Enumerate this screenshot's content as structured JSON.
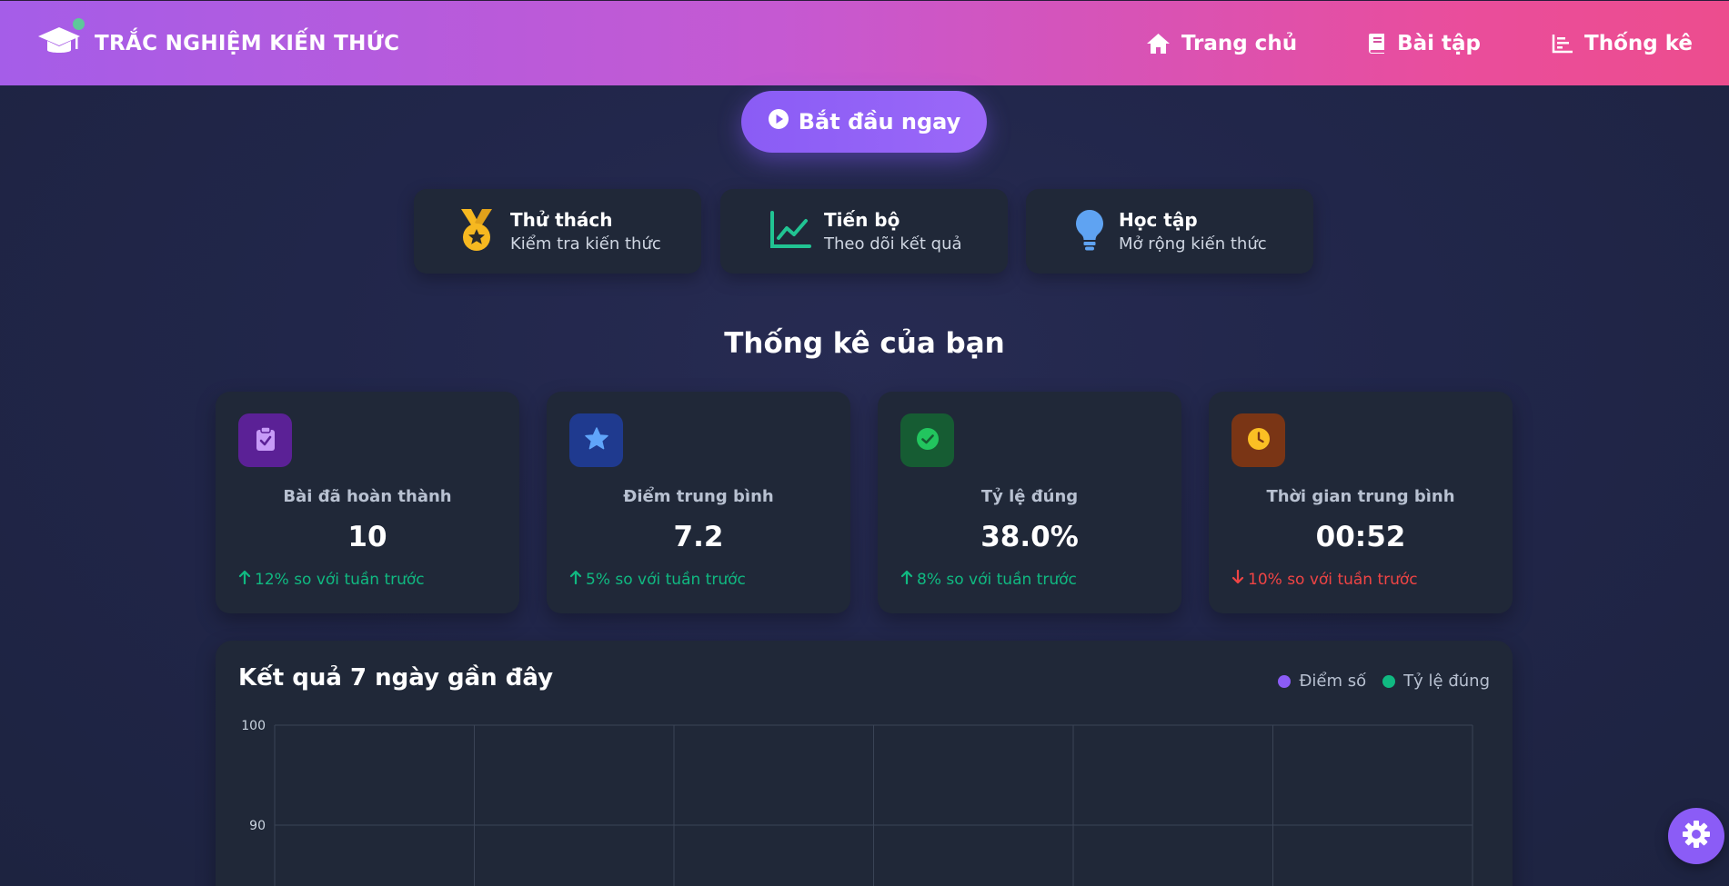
{
  "header": {
    "brand_title": "TRẮC NGHIỆM KIẾN THỨC",
    "nav": [
      {
        "label": "Trang chủ",
        "icon": "home-icon"
      },
      {
        "label": "Bài tập",
        "icon": "book-icon"
      },
      {
        "label": "Thống kê",
        "icon": "chart-bar-icon"
      }
    ]
  },
  "hero": {
    "start_label": "Bắt đầu ngay"
  },
  "features": [
    {
      "title": "Thử thách",
      "subtitle": "Kiểm tra kiến thức",
      "icon": "medal-icon",
      "color": "#f6b820"
    },
    {
      "title": "Tiến bộ",
      "subtitle": "Theo dõi kết quả",
      "icon": "line-chart-icon",
      "color": "#21c493"
    },
    {
      "title": "Học tập",
      "subtitle": "Mở rộng kiến thức",
      "icon": "lightbulb-icon",
      "color": "#5fa3f2"
    }
  ],
  "stats_section": {
    "title": "Thống kê của bạn",
    "cards": [
      {
        "label": "Bài đã hoàn thành",
        "value": "10",
        "trend": "12% so với tuần trước",
        "direction": "up",
        "icon": "clipboard-check-icon",
        "bg": "#5b2196",
        "fg": "#c79bf7"
      },
      {
        "label": "Điểm trung bình",
        "value": "7.2",
        "trend": "5% so với tuần trước",
        "direction": "up",
        "icon": "star-icon",
        "bg": "#1f3a8f",
        "fg": "#60a5fa"
      },
      {
        "label": "Tỷ lệ đúng",
        "value": "38.0%",
        "trend": "8% so với tuần trước",
        "direction": "up",
        "icon": "check-circle-icon",
        "bg": "#165c33",
        "fg": "#22c55e"
      },
      {
        "label": "Thời gian trung bình",
        "value": "00:52",
        "trend": "10% so với tuần trước",
        "direction": "down",
        "icon": "clock-icon",
        "bg": "#7a3515",
        "fg": "#fbbf24"
      }
    ]
  },
  "chart_section": {
    "title": "Kết quả 7 ngày gần đây",
    "legend": [
      {
        "label": "Điểm số",
        "color": "#8b5cf6"
      },
      {
        "label": "Tỷ lệ đúng",
        "color": "#10b981"
      }
    ]
  },
  "chart_data": {
    "type": "line",
    "title": "Kết quả 7 ngày gần đây",
    "xlabel": "",
    "ylabel": "",
    "y_ticks_visible": [
      100,
      90
    ],
    "ylim_visible": [
      90,
      100
    ],
    "grid": true,
    "x_gridlines": 7,
    "series": [
      {
        "name": "Điểm số",
        "color": "#8b5cf6",
        "values": []
      },
      {
        "name": "Tỷ lệ đúng",
        "color": "#10b981",
        "values": []
      }
    ]
  },
  "settings": {
    "icon": "gear-icon"
  }
}
